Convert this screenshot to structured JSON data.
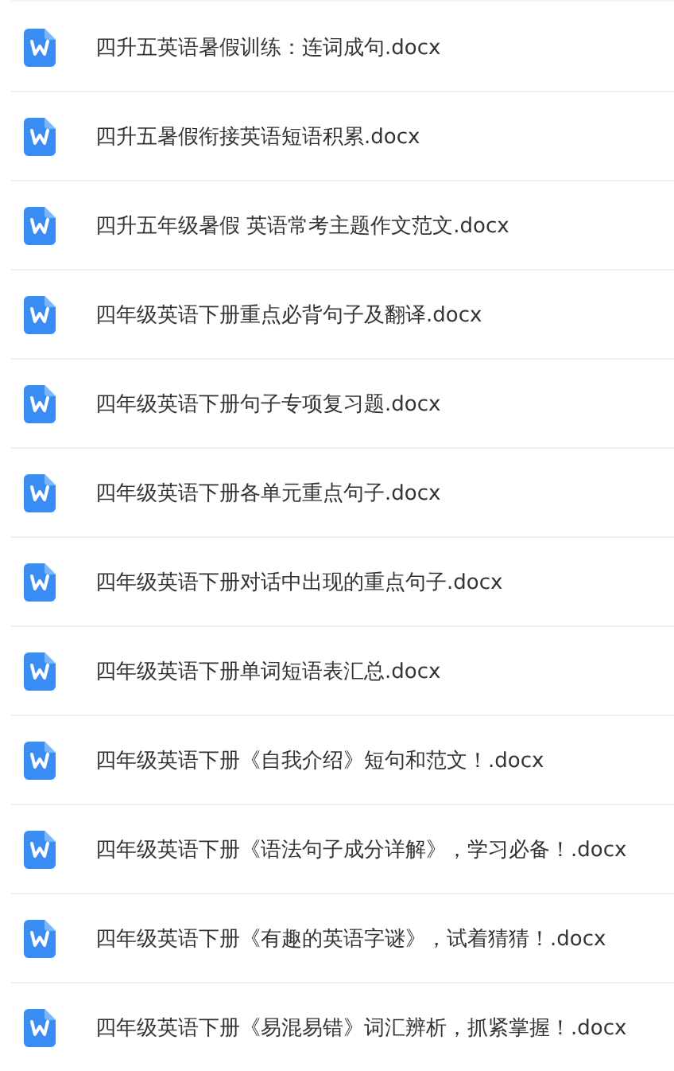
{
  "files": [
    {
      "name": "四升五英语暑假训练：连词成句.docx"
    },
    {
      "name": "四升五暑假衔接英语短语积累.docx"
    },
    {
      "name": "四升五年级暑假 英语常考主题作文范文.docx"
    },
    {
      "name": "四年级英语下册重点必背句子及翻译.docx"
    },
    {
      "name": "四年级英语下册句子专项复习题.docx"
    },
    {
      "name": "四年级英语下册各单元重点句子.docx"
    },
    {
      "name": "四年级英语下册对话中出现的重点句子.docx"
    },
    {
      "name": "四年级英语下册单词短语表汇总.docx"
    },
    {
      "name": "四年级英语下册《自我介绍》短句和范文！.docx"
    },
    {
      "name": "四年级英语下册《语法句子成分详解》，学习必备！.docx"
    },
    {
      "name": "四年级英语下册《有趣的英语字谜》，试着猜猜！.docx"
    },
    {
      "name": "四年级英语下册《易混易错》词汇辨析，抓紧掌握！.docx"
    }
  ]
}
